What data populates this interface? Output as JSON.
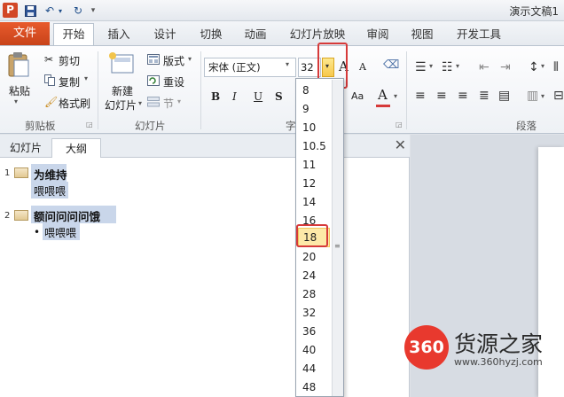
{
  "titlebar": {
    "app_letter": "P",
    "title": "演示文稿1"
  },
  "tabs": {
    "file": "文件",
    "items": [
      "开始",
      "插入",
      "设计",
      "切换",
      "动画",
      "幻灯片放映",
      "审阅",
      "视图",
      "开发工具"
    ]
  },
  "ribbon": {
    "paste": "粘贴",
    "cut": "剪切",
    "copy": "复制",
    "format_painter": "格式刷",
    "clipboard_group": "剪贴板",
    "new_slide_1": "新建",
    "new_slide_2": "幻灯片",
    "layout": "版式",
    "reset": "重设",
    "section": "节",
    "slides_group": "幻灯片",
    "font_name": "宋体 (正文)",
    "font_size": "32",
    "font_group_partial": "字",
    "bold": "B",
    "italic": "I",
    "underline": "U",
    "shadow": "S",
    "grow": "A",
    "shrink": "A",
    "paragraph_group": "段落",
    "change_case": "Aa",
    "font_color": "A"
  },
  "pane": {
    "tab_slides": "幻灯片",
    "tab_outline": "大纲",
    "close": "✕",
    "outline": [
      {
        "num": "1",
        "title": "为维持",
        "body": "喂喂喂",
        "bullet": ""
      },
      {
        "num": "2",
        "title": "额问问问问饿",
        "body": "喂喂喂",
        "bullet": "•"
      }
    ]
  },
  "font_size_dropdown": {
    "options": [
      "8",
      "9",
      "10",
      "10.5",
      "11",
      "12",
      "14",
      "16",
      "18",
      "20",
      "24",
      "28",
      "32",
      "36",
      "40",
      "44",
      "48"
    ],
    "selected": "18"
  },
  "watermark": {
    "logo": "360",
    "name": "货源之家",
    "url": "www.360hyzj.com"
  },
  "colors": {
    "file_tab": "#d24726",
    "highlight": "#c9d6ea",
    "selection": "#fde9a8",
    "red_frame": "#d63a3a"
  }
}
